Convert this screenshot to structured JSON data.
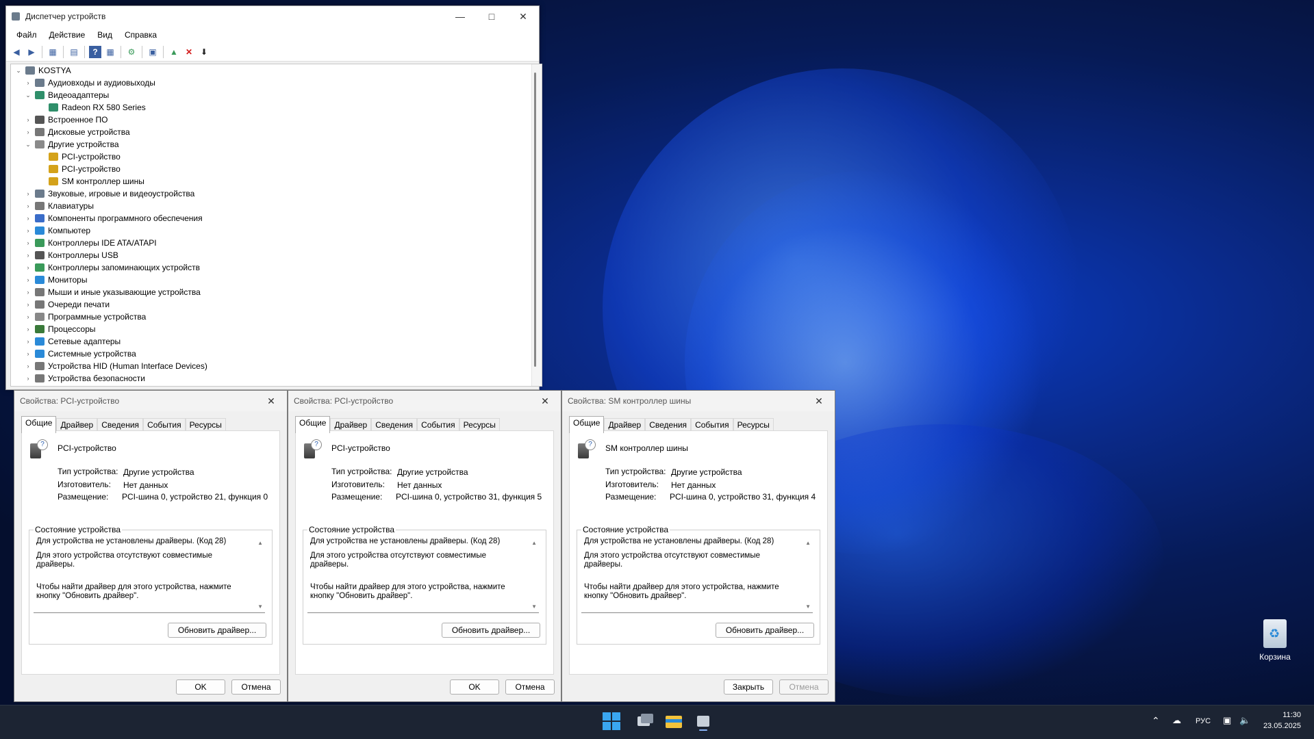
{
  "devmgr": {
    "title": "Диспетчер устройств",
    "menu": [
      "Файл",
      "Действие",
      "Вид",
      "Справка"
    ],
    "root": "KOSTYA",
    "tree": [
      {
        "label": "Аудиовходы и аудиовыходы",
        "level": 1,
        "expander": "›",
        "icon_color": "#6b7b8c"
      },
      {
        "label": "Видеоадаптеры",
        "level": 1,
        "expander": "⌄",
        "icon_color": "#2f8f6a"
      },
      {
        "label": "Radeon RX 580 Series",
        "level": 2,
        "expander": "",
        "icon_color": "#2f8f6a"
      },
      {
        "label": "Встроенное ПО",
        "level": 1,
        "expander": "›",
        "icon_color": "#555"
      },
      {
        "label": "Дисковые устройства",
        "level": 1,
        "expander": "›",
        "icon_color": "#777"
      },
      {
        "label": "Другие устройства",
        "level": 1,
        "expander": "⌄",
        "icon_color": "#8a8a8a"
      },
      {
        "label": "PCI-устройство",
        "level": 2,
        "expander": "",
        "icon_color": "#d4a21a"
      },
      {
        "label": "PCI-устройство",
        "level": 2,
        "expander": "",
        "icon_color": "#d4a21a"
      },
      {
        "label": "SM контроллер шины",
        "level": 2,
        "expander": "",
        "icon_color": "#d4a21a"
      },
      {
        "label": "Звуковые, игровые и видеоустройства",
        "level": 1,
        "expander": "›",
        "icon_color": "#6b7b8c"
      },
      {
        "label": "Клавиатуры",
        "level": 1,
        "expander": "›",
        "icon_color": "#777"
      },
      {
        "label": "Компоненты программного обеспечения",
        "level": 1,
        "expander": "›",
        "icon_color": "#3a6cc8"
      },
      {
        "label": "Компьютер",
        "level": 1,
        "expander": "›",
        "icon_color": "#2a8ad8"
      },
      {
        "label": "Контроллеры IDE ATA/ATAPI",
        "level": 1,
        "expander": "›",
        "icon_color": "#3a9a5a"
      },
      {
        "label": "Контроллеры USB",
        "level": 1,
        "expander": "›",
        "icon_color": "#555"
      },
      {
        "label": "Контроллеры запоминающих устройств",
        "level": 1,
        "expander": "›",
        "icon_color": "#3a9a5a"
      },
      {
        "label": "Мониторы",
        "level": 1,
        "expander": "›",
        "icon_color": "#2a8ad8"
      },
      {
        "label": "Мыши и иные указывающие устройства",
        "level": 1,
        "expander": "›",
        "icon_color": "#777"
      },
      {
        "label": "Очереди печати",
        "level": 1,
        "expander": "›",
        "icon_color": "#777"
      },
      {
        "label": "Программные устройства",
        "level": 1,
        "expander": "›",
        "icon_color": "#888"
      },
      {
        "label": "Процессоры",
        "level": 1,
        "expander": "›",
        "icon_color": "#3a7a3a"
      },
      {
        "label": "Сетевые адаптеры",
        "level": 1,
        "expander": "›",
        "icon_color": "#2a8ad8"
      },
      {
        "label": "Системные устройства",
        "level": 1,
        "expander": "›",
        "icon_color": "#2a8ad8"
      },
      {
        "label": "Устройства HID (Human Interface Devices)",
        "level": 1,
        "expander": "›",
        "icon_color": "#777"
      },
      {
        "label": "Устройства безопасности",
        "level": 1,
        "expander": "›",
        "icon_color": "#777"
      }
    ]
  },
  "common": {
    "tabs": [
      "Общие",
      "Драйвер",
      "Сведения",
      "События",
      "Ресурсы"
    ],
    "type_label": "Тип устройства:",
    "maker_label": "Изготовитель:",
    "location_label": "Размещение:",
    "type_value": "Другие устройства",
    "maker_value": "Нет данных",
    "status_group": "Состояние устройства",
    "status_line1": "Для устройства не установлены драйверы. (Код 28)",
    "status_line2": "Для этого устройства отсутствуют совместимые драйверы.",
    "status_line3": "Чтобы найти драйвер для этого устройства, нажмите кнопку \"Обновить драйвер\".",
    "update_button": "Обновить драйвер..."
  },
  "dialogs": [
    {
      "title": "Свойства: PCI-устройство",
      "device": "PCI-устройство",
      "location": "PCI-шина 0, устройство 21, функция 0",
      "btn1": "OK",
      "btn2": "Отмена",
      "btn2_disabled": false
    },
    {
      "title": "Свойства: PCI-устройство",
      "device": "PCI-устройство",
      "location": "PCI-шина 0, устройство 31, функция 5",
      "btn1": "OK",
      "btn2": "Отмена",
      "btn2_disabled": false
    },
    {
      "title": "Свойства: SM контроллер шины",
      "device": "SM контроллер шины",
      "location": "PCI-шина 0, устройство 31, функция 4",
      "btn1": "Закрыть",
      "btn2": "Отмена",
      "btn2_disabled": true
    }
  ],
  "desktop": {
    "recycle_bin": "Корзина"
  },
  "taskbar": {
    "lang": "РУС",
    "time": "11:30",
    "date": "23.05.2025"
  }
}
